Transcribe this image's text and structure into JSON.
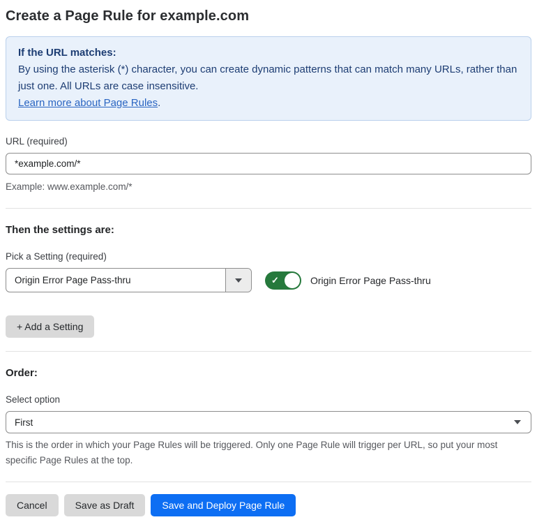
{
  "page": {
    "title": "Create a Page Rule for example.com"
  },
  "info_box": {
    "heading": "If the URL matches:",
    "body": "By using the asterisk (*) character, you can create dynamic patterns that can match many URLs, rather than just one. All URLs are case insensitive.",
    "link_label": "Learn more about Page Rules",
    "link_suffix": "."
  },
  "url_field": {
    "label": "URL (required)",
    "value": "*example.com/*",
    "helper": "Example: www.example.com/*"
  },
  "settings_section": {
    "heading": "Then the settings are:",
    "picker_label": "Pick a Setting (required)",
    "picker_value": "Origin Error Page Pass-thru",
    "toggle": {
      "state": "on",
      "label": "Origin Error Page Pass-thru"
    },
    "add_setting_label": "+ Add a Setting"
  },
  "order_section": {
    "heading": "Order:",
    "select_label": "Select option",
    "select_value": "First",
    "helper": "This is the order in which your Page Rules will be triggered. Only one Page Rule will trigger per URL, so put your most specific Page Rules at the top."
  },
  "footer": {
    "cancel_label": "Cancel",
    "save_draft_label": "Save as Draft",
    "save_deploy_label": "Save and Deploy Page Rule"
  },
  "icons": {
    "caret_down": "css-triangle-down",
    "check": "✓"
  },
  "colors": {
    "info_background": "#e9f1fb",
    "info_border": "#bad0ec",
    "info_text": "#1d3d73",
    "link": "#2a65c2",
    "toggle_on_green": "#26793c",
    "primary_button_blue": "#0d6ef3",
    "secondary_button_gray": "#d9d9d9",
    "divider": "#e2e2e2",
    "input_border": "#8d8d8d"
  }
}
